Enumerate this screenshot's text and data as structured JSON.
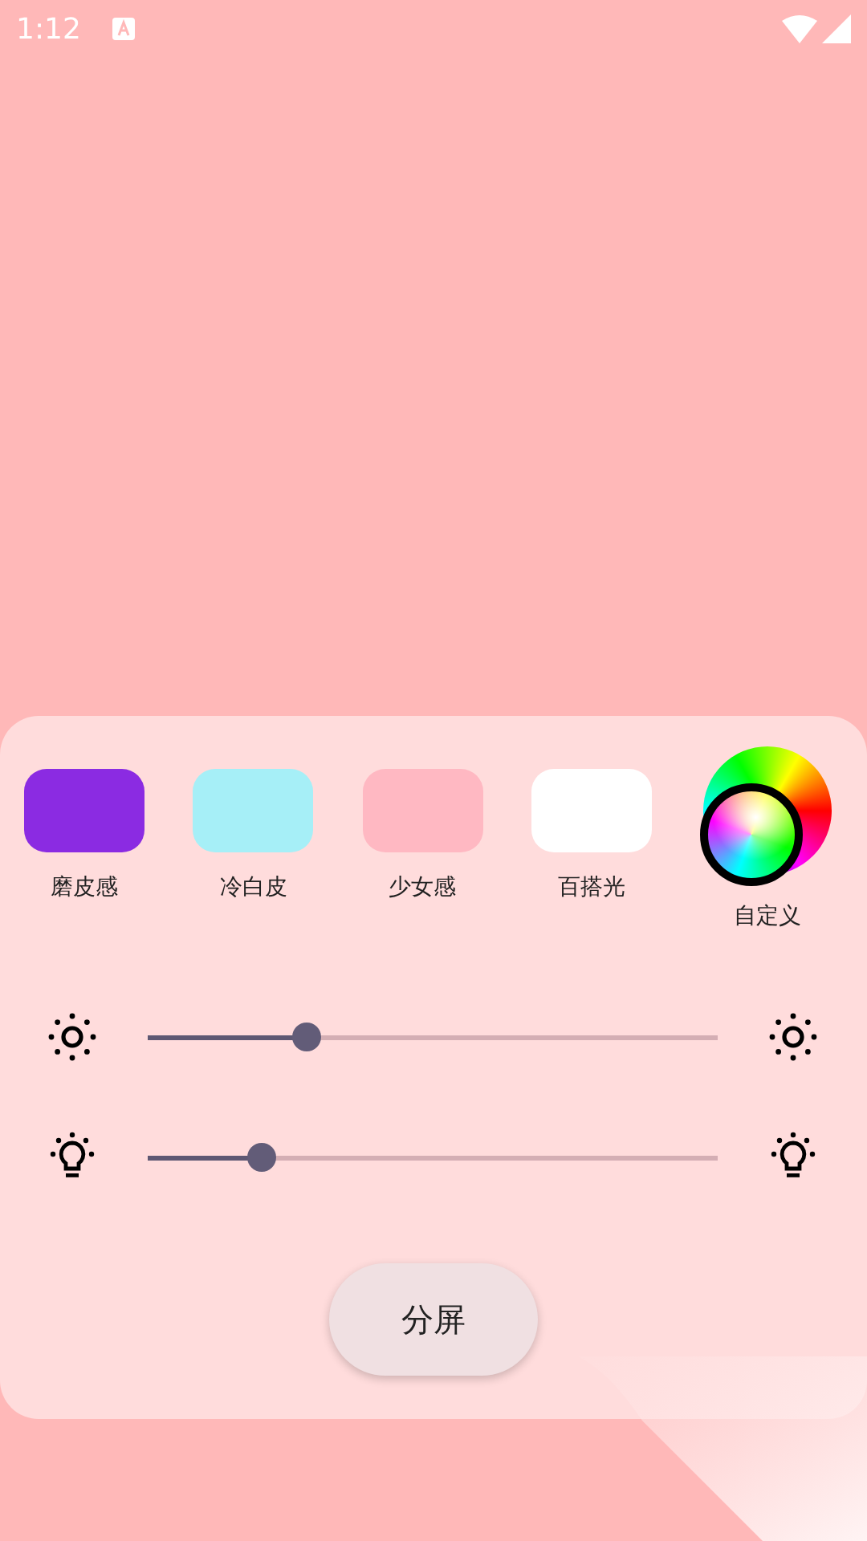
{
  "status_bar": {
    "time": "1:12"
  },
  "presets": [
    {
      "kind": "swatch",
      "label": "磨皮感",
      "color": "#8b2be2"
    },
    {
      "kind": "swatch",
      "label": "冷白皮",
      "color": "#a6eff7"
    },
    {
      "kind": "swatch",
      "label": "少女感",
      "color": "#ffb8c2"
    },
    {
      "kind": "swatch",
      "label": "百搭光",
      "color": "#ffffff"
    },
    {
      "kind": "wheel",
      "label": "自定义"
    }
  ],
  "sliders": [
    {
      "kind": "brightness",
      "level": 0.28
    },
    {
      "kind": "warmth",
      "level": 0.2
    }
  ],
  "split_button": {
    "label": "分屏"
  }
}
